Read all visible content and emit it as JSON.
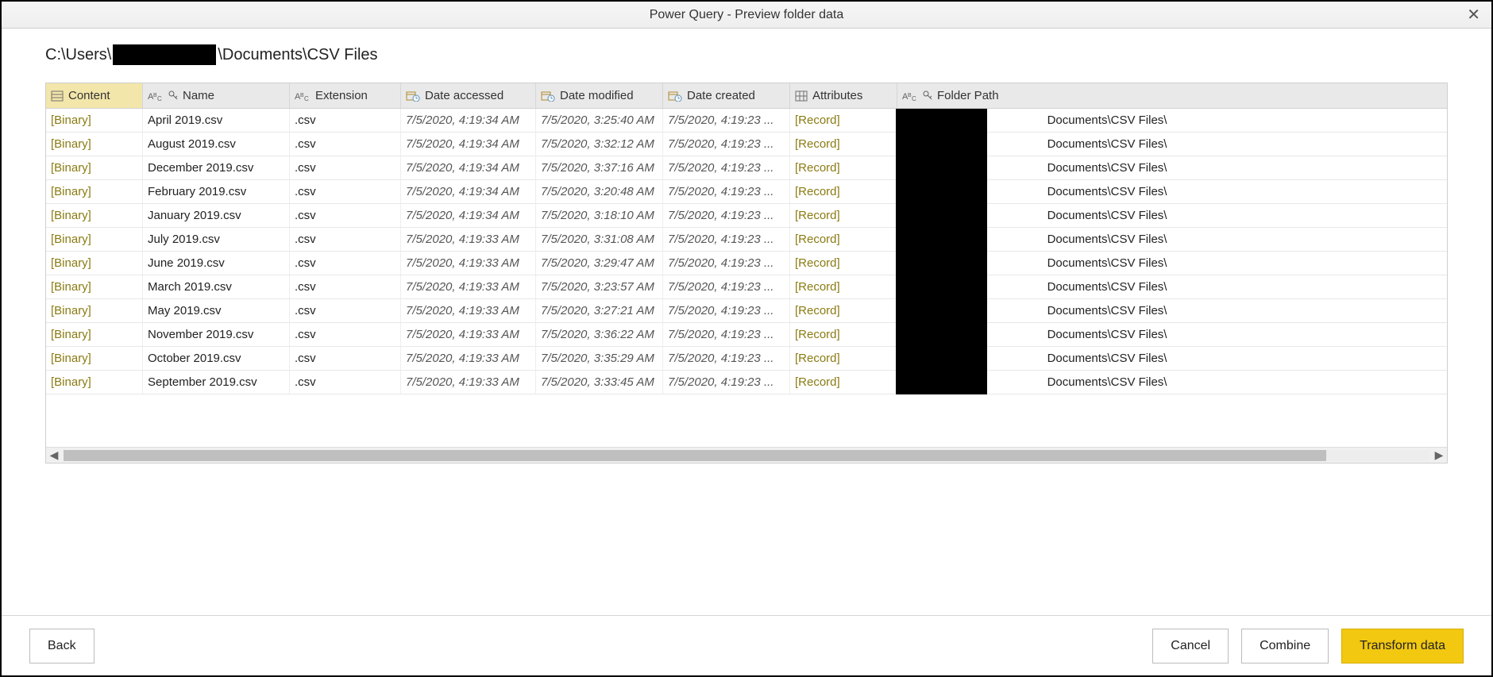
{
  "window": {
    "title": "Power Query - Preview folder data"
  },
  "path": {
    "prefix": "C:\\Users\\",
    "suffix": "\\Documents\\CSV Files"
  },
  "columns": {
    "content": {
      "label": "Content"
    },
    "name": {
      "label": "Name"
    },
    "ext": {
      "label": "Extension"
    },
    "accessed": {
      "label": "Date accessed"
    },
    "modified": {
      "label": "Date modified"
    },
    "created": {
      "label": "Date created"
    },
    "attrs": {
      "label": "Attributes"
    },
    "folder": {
      "label": "Folder Path"
    }
  },
  "cell_tokens": {
    "binary": "[Binary]",
    "record": "[Record]",
    "folder_prefix": "C:\\Users\\",
    "folder_suffix": "Documents\\CSV Files\\"
  },
  "rows": [
    {
      "name": "April 2019.csv",
      "ext": ".csv",
      "accessed": "7/5/2020, 4:19:34 AM",
      "modified": "7/5/2020, 3:25:40 AM",
      "created": "7/5/2020, 4:19:23 ..."
    },
    {
      "name": "August 2019.csv",
      "ext": ".csv",
      "accessed": "7/5/2020, 4:19:34 AM",
      "modified": "7/5/2020, 3:32:12 AM",
      "created": "7/5/2020, 4:19:23 ..."
    },
    {
      "name": "December 2019.csv",
      "ext": ".csv",
      "accessed": "7/5/2020, 4:19:34 AM",
      "modified": "7/5/2020, 3:37:16 AM",
      "created": "7/5/2020, 4:19:23 ..."
    },
    {
      "name": "February 2019.csv",
      "ext": ".csv",
      "accessed": "7/5/2020, 4:19:34 AM",
      "modified": "7/5/2020, 3:20:48 AM",
      "created": "7/5/2020, 4:19:23 ..."
    },
    {
      "name": "January 2019.csv",
      "ext": ".csv",
      "accessed": "7/5/2020, 4:19:34 AM",
      "modified": "7/5/2020, 3:18:10 AM",
      "created": "7/5/2020, 4:19:23 ..."
    },
    {
      "name": "July 2019.csv",
      "ext": ".csv",
      "accessed": "7/5/2020, 4:19:33 AM",
      "modified": "7/5/2020, 3:31:08 AM",
      "created": "7/5/2020, 4:19:23 ..."
    },
    {
      "name": "June 2019.csv",
      "ext": ".csv",
      "accessed": "7/5/2020, 4:19:33 AM",
      "modified": "7/5/2020, 3:29:47 AM",
      "created": "7/5/2020, 4:19:23 ..."
    },
    {
      "name": "March 2019.csv",
      "ext": ".csv",
      "accessed": "7/5/2020, 4:19:33 AM",
      "modified": "7/5/2020, 3:23:57 AM",
      "created": "7/5/2020, 4:19:23 ..."
    },
    {
      "name": "May 2019.csv",
      "ext": ".csv",
      "accessed": "7/5/2020, 4:19:33 AM",
      "modified": "7/5/2020, 3:27:21 AM",
      "created": "7/5/2020, 4:19:23 ..."
    },
    {
      "name": "November 2019.csv",
      "ext": ".csv",
      "accessed": "7/5/2020, 4:19:33 AM",
      "modified": "7/5/2020, 3:36:22 AM",
      "created": "7/5/2020, 4:19:23 ..."
    },
    {
      "name": "October 2019.csv",
      "ext": ".csv",
      "accessed": "7/5/2020, 4:19:33 AM",
      "modified": "7/5/2020, 3:35:29 AM",
      "created": "7/5/2020, 4:19:23 ..."
    },
    {
      "name": "September 2019.csv",
      "ext": ".csv",
      "accessed": "7/5/2020, 4:19:33 AM",
      "modified": "7/5/2020, 3:33:45 AM",
      "created": "7/5/2020, 4:19:23 ..."
    }
  ],
  "buttons": {
    "back": "Back",
    "cancel": "Cancel",
    "combine": "Combine",
    "transform": "Transform data"
  }
}
